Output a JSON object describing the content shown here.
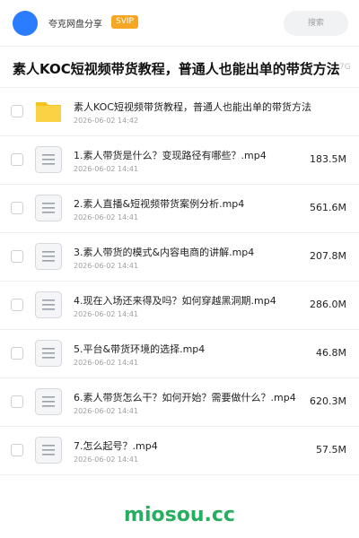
{
  "header": {
    "share_name": "夸克网盘分享",
    "badge": "SVIP",
    "search_label": "搜索"
  },
  "page": {
    "title": "素人KOC短视频带货教程，普通人也能出单的带货方法",
    "title_size": "7G"
  },
  "files": [
    {
      "type": "folder",
      "name": "素人KOC短视频带货教程，普通人也能出单的带货方法",
      "date": "2026-06-02 14:42",
      "size": ""
    },
    {
      "type": "doc",
      "name": "1.素人带货是什么？变现路径有哪些？.mp4",
      "date": "2026-06-02 14:41",
      "size": "183.5M"
    },
    {
      "type": "doc",
      "name": "2.素人直播&短视频带货案例分析.mp4",
      "date": "2026-06-02 14:41",
      "size": "561.6M"
    },
    {
      "type": "doc",
      "name": "3.素人带货的模式&内容电商的讲解.mp4",
      "date": "2026-06-02 14:41",
      "size": "207.8M"
    },
    {
      "type": "doc",
      "name": "4.现在入场还来得及吗？如何穿越黑洞期.mp4",
      "date": "2026-06-02 14:41",
      "size": "286.0M"
    },
    {
      "type": "doc",
      "name": "5.平台&带货环境的选择.mp4",
      "date": "2026-06-02 14:41",
      "size": "46.8M"
    },
    {
      "type": "doc",
      "name": "6.素人带货怎么干？如何开始？需要做什么？.mp4",
      "date": "2026-06-02 14:41",
      "size": "620.3M"
    },
    {
      "type": "doc",
      "name": "7.怎么起号？.mp4",
      "date": "2026-06-02 14:41",
      "size": "57.5M"
    }
  ],
  "watermark": "miosou.cc",
  "colors": {
    "avatar": "#2b7cff",
    "badge": "#f5a623",
    "folder": "#f7c21b",
    "watermark": "#27ae60"
  }
}
